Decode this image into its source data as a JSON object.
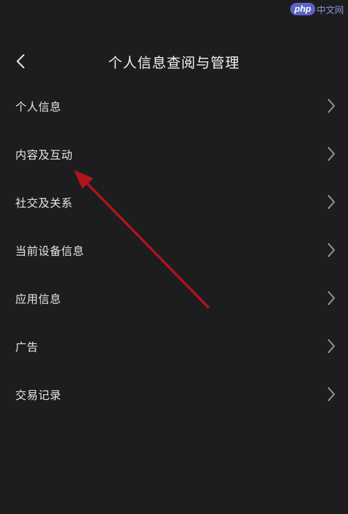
{
  "watermark": {
    "logo": "php",
    "text": "中文网"
  },
  "header": {
    "title": "个人信息查阅与管理",
    "back_icon": "chevron-left-icon"
  },
  "menu": {
    "items": [
      {
        "label": "个人信息"
      },
      {
        "label": "内容及互动"
      },
      {
        "label": "社交及关系"
      },
      {
        "label": "当前设备信息"
      },
      {
        "label": "应用信息"
      },
      {
        "label": "广告"
      },
      {
        "label": "交易记录"
      }
    ],
    "item_icon": "chevron-right-icon"
  },
  "colors": {
    "background": "#1d1d1f",
    "text": "#e6e6e6",
    "chevron": "#9a9a9a",
    "annotation": "#b0141c",
    "watermark_badge": "#5b63c6"
  }
}
